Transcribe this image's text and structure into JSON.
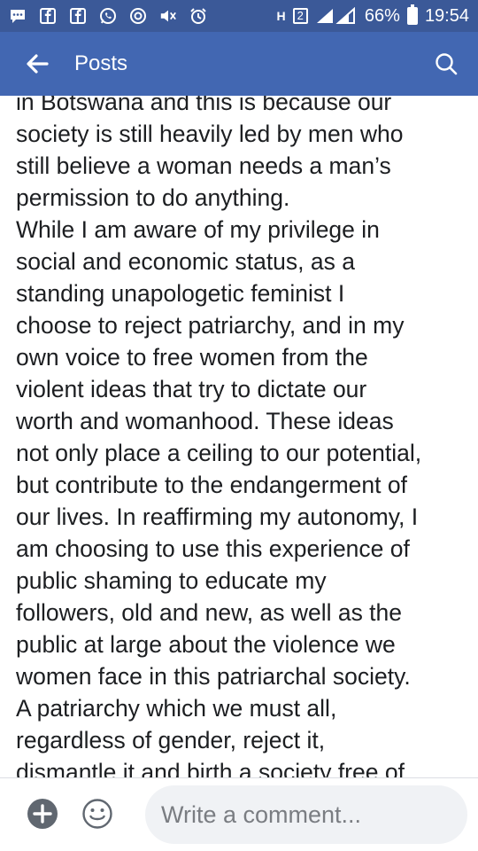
{
  "status_bar": {
    "battery": "66%",
    "time": "19:54",
    "sim_label": "2",
    "network_label": "H",
    "icons": [
      "messenger-icon",
      "facebook-icon",
      "facebook-icon",
      "whatsapp-icon",
      "sync-icon",
      "mute-icon",
      "alarm-icon",
      "signal-icon",
      "battery-icon"
    ]
  },
  "app_bar": {
    "title": "Posts",
    "back_icon": "arrow-left-icon",
    "search_icon": "search-icon"
  },
  "post": {
    "lines": [
      "in Botswana and this is because our",
      "society is still heavily led by men who",
      "still believe a woman needs a man’s",
      "permission to do anything.",
      "While I am aware of my privilege in",
      "social and economic status, as a",
      "standing unapologetic feminist I",
      "choose to reject patriarchy, and in my",
      "own voice to free women from the",
      "violent ideas that try to dictate our",
      "worth and womanhood. These ideas",
      "not only place a ceiling to our potential,",
      "but contribute to the endangerment of",
      "our lives. In reaffirming my autonomy, I",
      "am choosing to use this experience of",
      "public shaming to educate my",
      "followers, old and new, as well as the",
      "public at large about the violence we",
      "women face in this patriarchal society.",
      "A patriarchy which we must all,",
      "regardless of gender, reject it,",
      "dismantle it and birth a society free of"
    ]
  },
  "comment_bar": {
    "placeholder": "Write a comment...",
    "add_icon": "plus-circle-icon",
    "emoji_icon": "smiley-icon"
  },
  "colors": {
    "status_bar": "#3b5998",
    "app_bar": "#4267b2",
    "text": "#1c1e21",
    "input_bg": "#f0f2f5"
  }
}
